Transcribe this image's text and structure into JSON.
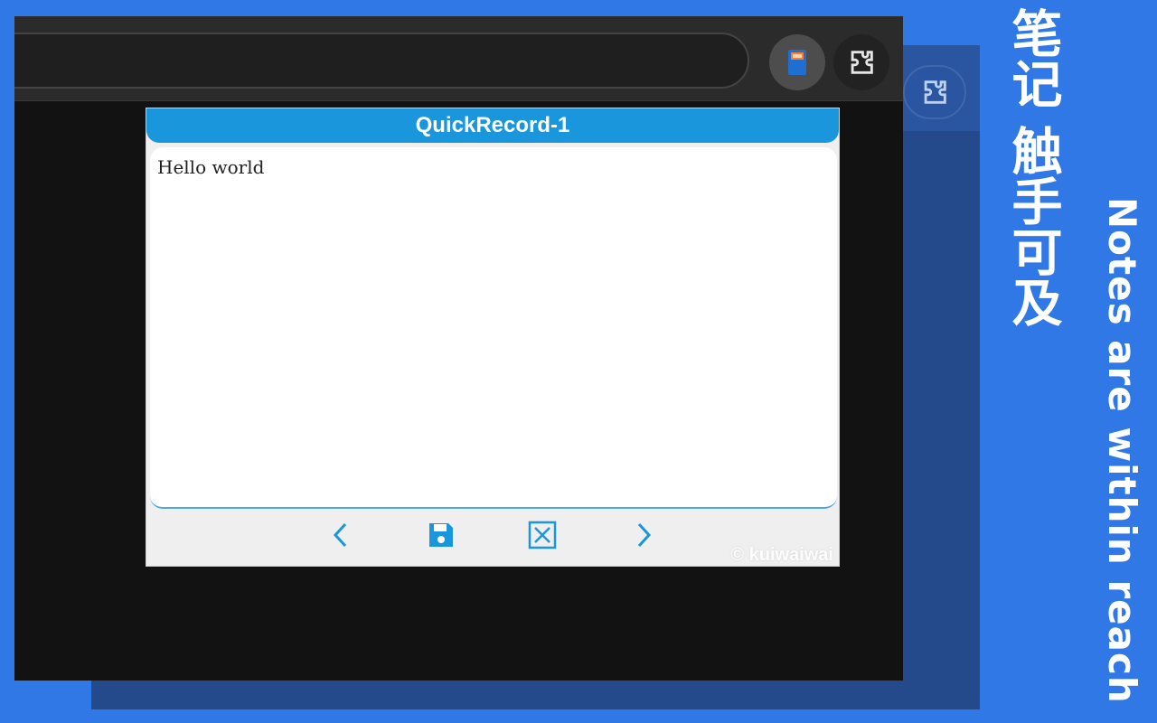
{
  "popup": {
    "title": "QuickRecord-1",
    "note_text": "Hello world",
    "watermark": "© kuiwaiwai"
  },
  "footer": {
    "prev_icon": "chevron-left-icon",
    "save_icon": "save-icon",
    "close_icon": "close-box-icon",
    "next_icon": "chevron-right-icon"
  },
  "toolbar": {
    "extension_icon": "notebook-icon",
    "extensions_icon": "puzzle-icon"
  },
  "banner": {
    "cn_line1": "笔记",
    "cn_line2": "触手可及",
    "en_tagline": "Notes are within reach"
  },
  "colors": {
    "background": "#2f78e6",
    "accent": "#1a96dc"
  }
}
